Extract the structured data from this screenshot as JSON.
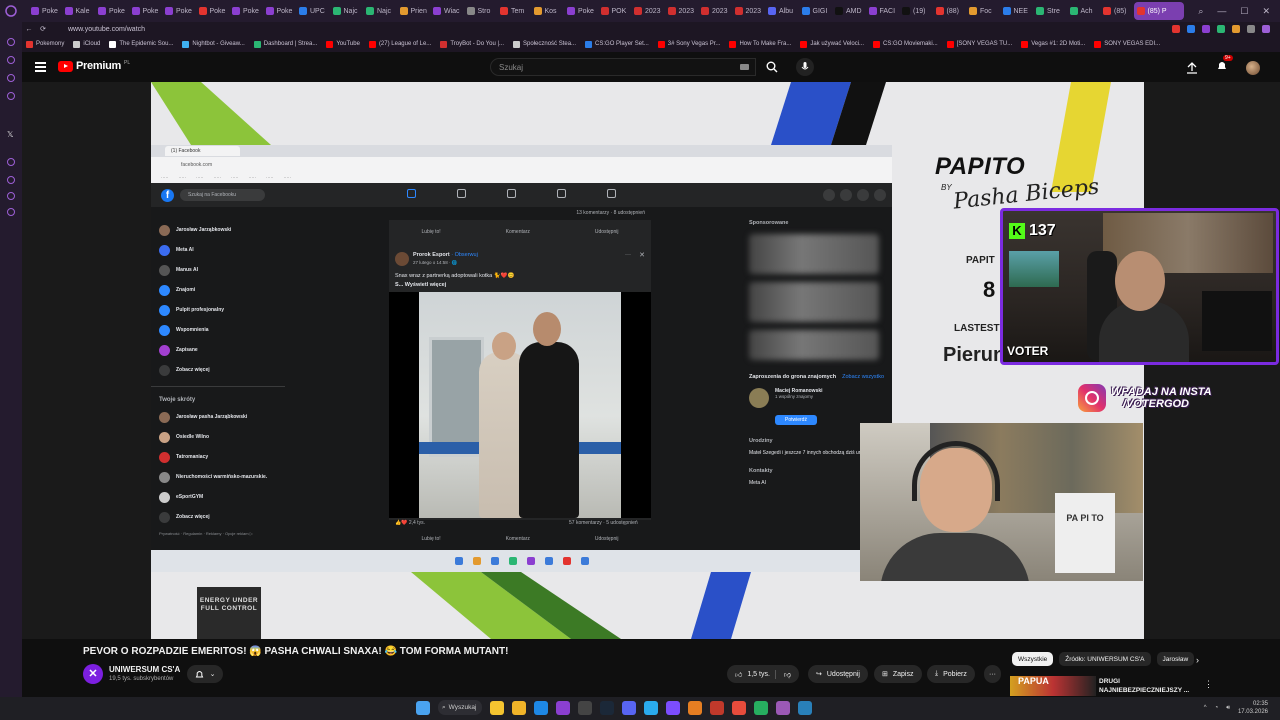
{
  "browser": {
    "tabs": [
      {
        "label": "Poke",
        "color": "#8b3fd0"
      },
      {
        "label": "Kale",
        "color": "#8b3fd0"
      },
      {
        "label": "Poke",
        "color": "#8b3fd0"
      },
      {
        "label": "Poke",
        "color": "#8b3fd0"
      },
      {
        "label": "Poke",
        "color": "#8b3fd0"
      },
      {
        "label": "Poke",
        "color": "#e3342f"
      },
      {
        "label": "Poke",
        "color": "#8b3fd0"
      },
      {
        "label": "Poke",
        "color": "#8b3fd0"
      },
      {
        "label": "UPC",
        "color": "#2b7de9"
      },
      {
        "label": "Najc",
        "color": "#2bb673"
      },
      {
        "label": "Najc",
        "color": "#2bb673"
      },
      {
        "label": "Prien",
        "color": "#e39a2f"
      },
      {
        "label": "Wiac",
        "color": "#8b3fd0"
      },
      {
        "label": "Stro",
        "color": "#888888"
      },
      {
        "label": "Tem",
        "color": "#e3342f"
      },
      {
        "label": "Kos",
        "color": "#e39a2f"
      },
      {
        "label": "Poke",
        "color": "#8b3fd0"
      },
      {
        "label": "POK",
        "color": "#d02f2f"
      },
      {
        "label": "2023",
        "color": "#d02f2f"
      },
      {
        "label": "2023",
        "color": "#d02f2f"
      },
      {
        "label": "2023",
        "color": "#d02f2f"
      },
      {
        "label": "2023",
        "color": "#d02f2f"
      },
      {
        "label": "Albu",
        "color": "#5865f2"
      },
      {
        "label": "GIGI",
        "color": "#2b7de9"
      },
      {
        "label": "AMD",
        "color": "#111111"
      },
      {
        "label": "FACI",
        "color": "#8b3fd0"
      },
      {
        "label": "(19)",
        "color": "#111111"
      },
      {
        "label": "(88)",
        "color": "#e3342f"
      },
      {
        "label": "Foc",
        "color": "#e39a2f"
      },
      {
        "label": "NEE",
        "color": "#2b7de9"
      },
      {
        "label": "Stre",
        "color": "#2bb673"
      },
      {
        "label": "Ach",
        "color": "#2bb673"
      },
      {
        "label": "(85)",
        "color": "#e3342f"
      }
    ],
    "active_tab": {
      "label": "(85) P",
      "color": "#e3342f"
    },
    "url": "www.youtube.com/watch",
    "bookmarks": [
      {
        "label": "Pokemony",
        "color": "#e3342f"
      },
      {
        "label": "iCloud",
        "color": "#cccccc"
      },
      {
        "label": "The Epidemic Sou...",
        "color": "#ffffff"
      },
      {
        "label": "Nightbot - Giveaw...",
        "color": "#3fb0f0"
      },
      {
        "label": "Dashboard | Strea...",
        "color": "#2bb673"
      },
      {
        "label": "YouTube",
        "color": "#ff0000"
      },
      {
        "label": "(27) League of Le...",
        "color": "#ff0000"
      },
      {
        "label": "TroyBot - Do You |...",
        "color": "#d02f2f"
      },
      {
        "label": "Społeczność Stea...",
        "color": "#cccccc"
      },
      {
        "label": "CS:GO Player Set...",
        "color": "#2b7de9"
      },
      {
        "label": "3# Sony Vegas Pr...",
        "color": "#ff0000"
      },
      {
        "label": "How To Make Fra...",
        "color": "#ff0000"
      },
      {
        "label": "Jak używać Veloci...",
        "color": "#ff0000"
      },
      {
        "label": "CS:GO Moviemaki...",
        "color": "#ff0000"
      },
      {
        "label": "[SONY VEGAS TU...",
        "color": "#ff0000"
      },
      {
        "label": "Vegas #1: 2D Moti...",
        "color": "#ff0000"
      },
      {
        "label": "SONY VEGAS EDI...",
        "color": "#ff0000"
      }
    ]
  },
  "youtube": {
    "logo_text": "Premium",
    "logo_sup": "PL",
    "search_placeholder": "Szukaj",
    "notif_count": "9+",
    "accent": "#ff0000"
  },
  "stream": {
    "papito_title": "PAPITO",
    "papito_by": "BY",
    "papito_sig": "Pasha Biceps",
    "papito_sub": "PAPIT",
    "papito_num": "8",
    "lastest": "LASTEST",
    "pierun": "Pierun",
    "energy_logo": "ENERGY UNDER FULL CONTROL",
    "kick_viewers": "137",
    "kick_letter": "K",
    "voter_tag": "VOTER",
    "insta_line1": "WPADAJ NA INSTA",
    "insta_line2": "/VOTERGOD",
    "box_text": "PA PI TO"
  },
  "facebook": {
    "tab_title": "(1) Facebook",
    "url": "facebook.com",
    "search_placeholder": "Szukaj na Facebooku",
    "left_menu": [
      {
        "label": "Jarosław Jarząbkowski",
        "color": "#8a6a55"
      },
      {
        "label": "Meta AI",
        "color": "#3b6cf0"
      },
      {
        "label": "Manus AI",
        "color": "#555555"
      },
      {
        "label": "Znajomi",
        "color": "#2d88ff"
      },
      {
        "label": "Pulpit profesjonalny",
        "color": "#2d88ff"
      },
      {
        "label": "Wspomnienia",
        "color": "#2d88ff"
      },
      {
        "label": "Zapisane",
        "color": "#a23fd0"
      },
      {
        "label": "Zobacz więcej",
        "color": "#3a3b3c"
      }
    ],
    "shortcuts_header": "Twoje skróty",
    "shortcuts": [
      {
        "label": "Jarosław pasha Jarząbkowski",
        "color": "#8a6a55"
      },
      {
        "label": "Osiedle Wilno",
        "color": "#c9a285"
      },
      {
        "label": "Tatromaniacy",
        "color": "#d02f2f"
      },
      {
        "label": "Nieruchomości warmińsko-mazurskie.",
        "color": "#888888"
      },
      {
        "label": "eSportGYM",
        "color": "#cccccc"
      },
      {
        "label": "Zobacz więcej",
        "color": "#3a3b3c"
      }
    ],
    "footer": "Prywatność · Regulamin · Reklamy · Opcje reklam ▷",
    "prev_post_comments": "13 komentarzy · 8 udostępnień",
    "actions": {
      "like": "Lubię to!",
      "comment": "Komentarz",
      "share": "Udostępnij"
    },
    "post": {
      "author": "Prorok Esport",
      "follow": "· Obserwuj",
      "date": "27 lutego o 14:58 · 🌐",
      "caption": "Snax wraz z partnerką adoptowali kotka 🐈❤️😊",
      "see_more": "S... Wyświetl więcej",
      "likes": "2,4 tys.",
      "counts": "57 komentarzy · 5 udostępnień"
    },
    "sponsored": "Sponsorowane",
    "invites_header": "Zaproszenia do grona znajomych",
    "see_all": "Zobacz wszystko",
    "invite_person": "Maciej Romanowski",
    "invite_mutual": "1 wspólny znajomy",
    "confirm": "Potwierdź",
    "birthdays_header": "Urodziny",
    "birthday_text": "Mateł Szegedi i jeszcze 7 innych obchodzą dziś urodziny.",
    "contacts_header": "Kontakty",
    "contact": "Meta AI"
  },
  "video_info": {
    "title": "PEVOR O ROZPADZIE EMERITOS! 😱 PASHA CHWALI SNAXA! 😂 TOM FORMA MUTANT!",
    "channel": "UNIWERSUM CS'A",
    "subs": "19,5 tys. subskrybentów",
    "likes": "1,5 tys.",
    "share": "Udostępnij",
    "save": "Zapisz",
    "download": "Pobierz",
    "chips": [
      "Wszystkie",
      "Źródło: UNIWERSUM CS'A",
      "Jarosław"
    ],
    "rec_thumb_text": "PAPUA",
    "rec_title_line1": "DRUGI",
    "rec_title_line2": "NAJNIEBEZPIECZNIEJSZY ..."
  },
  "taskbar": {
    "search": "Wyszukaj",
    "time": "02:35",
    "date": "17.03.2026"
  }
}
